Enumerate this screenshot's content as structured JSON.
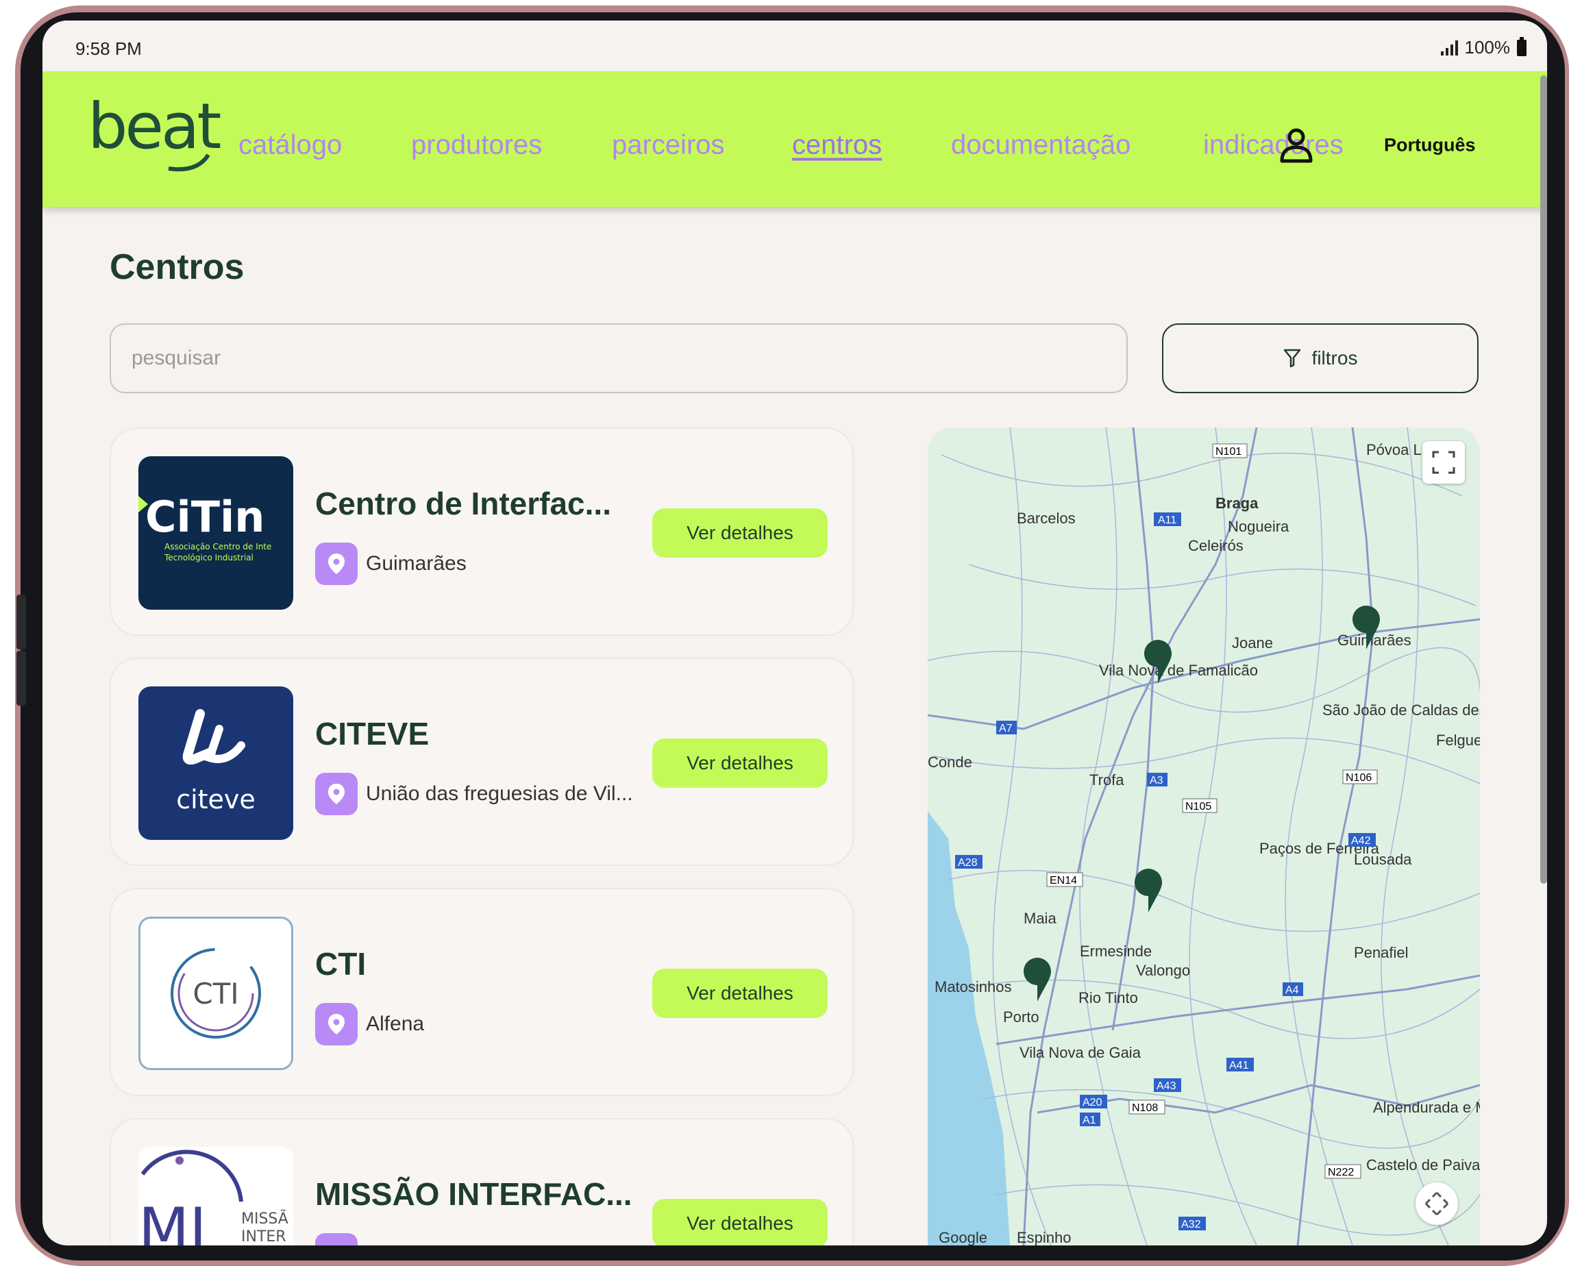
{
  "status": {
    "time": "9:58 PM",
    "battery": "100%"
  },
  "nav": {
    "logo_text": "beat",
    "items": [
      {
        "label": "catálogo",
        "active": false
      },
      {
        "label": "produtores",
        "active": false
      },
      {
        "label": "parceiros",
        "active": false
      },
      {
        "label": "centros",
        "active": true
      },
      {
        "label": "documentação",
        "active": false
      },
      {
        "label": "indicadores",
        "active": false
      }
    ],
    "language": "Português"
  },
  "page": {
    "title": "Centros",
    "search_placeholder": "pesquisar",
    "filters_label": "filtros"
  },
  "centers": [
    {
      "name": "Centro de Interfac...",
      "location": "Guimarães",
      "button": "Ver detalhes",
      "logo": {
        "text": "CiTin",
        "sub1": "Associação Centro de Inte",
        "sub2": "Tecnológico Industrial"
      }
    },
    {
      "name": "CITEVE",
      "location": "União das freguesias de Vil...",
      "button": "Ver detalhes",
      "logo": {
        "text": "citeve"
      }
    },
    {
      "name": "CTI",
      "location": "Alfena",
      "button": "Ver detalhes",
      "logo": {
        "text": "CTI"
      }
    },
    {
      "name": "MISSÃO INTERFAC...",
      "location": "",
      "button": "Ver detalhes",
      "logo": {
        "text": "MI",
        "sub1": "MISSÃ",
        "sub2": "INTER"
      }
    }
  ],
  "map": {
    "labels": [
      "Braga",
      "Barcelos",
      "Nogueira",
      "Celeirós",
      "Joane",
      "Guimarães",
      "Vila Nova de Famalicão",
      "São João de Caldas de Vizela",
      "Trofa",
      "Paços de Ferreira",
      "Lousada",
      "Maia",
      "Ermesinde",
      "Valongo",
      "Penafiel",
      "Matosinhos",
      "Porto",
      "Rio Tinto",
      "Vila Nova de Gaia",
      "Alpendurada e Matos",
      "Castelo de Paiva",
      "Espinho",
      "Póvoa Lanho",
      "Felgue",
      "Conde",
      "Google"
    ],
    "road_codes": [
      "N101",
      "A11",
      "A7",
      "A3",
      "N105",
      "N106",
      "A42",
      "A28",
      "EN14",
      "A4",
      "A41",
      "A43",
      "A20",
      "A1",
      "N108",
      "N222",
      "A32"
    ],
    "colors": {
      "land": "#dff1e3",
      "water": "#9dd3ea",
      "pin": "#1f4e3a"
    }
  },
  "colors": {
    "accent": "#c4fa58",
    "nav_link": "#b385f0",
    "title": "#1f3d2c",
    "pin_bg": "#b98af5"
  }
}
